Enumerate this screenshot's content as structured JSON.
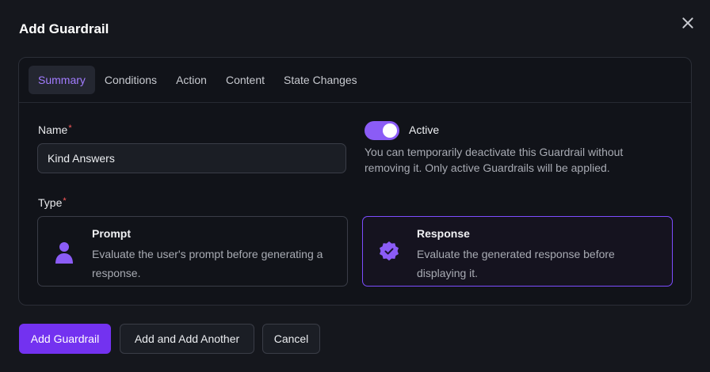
{
  "modal": {
    "title": "Add Guardrail"
  },
  "tabs": [
    {
      "label": "Summary",
      "active": true
    },
    {
      "label": "Conditions",
      "active": false
    },
    {
      "label": "Action",
      "active": false
    },
    {
      "label": "Content",
      "active": false
    },
    {
      "label": "State Changes",
      "active": false
    }
  ],
  "form": {
    "name_label": "Name",
    "name_value": "Kind Answers",
    "required_mark": "*",
    "active_label": "Active",
    "active_enabled": true,
    "active_description": "You can temporarily deactivate this Guardrail without removing it. Only active Guardrails will be applied.",
    "type_label": "Type",
    "types": [
      {
        "title": "Prompt",
        "description": "Evaluate the user's prompt before generating a response.",
        "icon": "user-icon",
        "selected": false
      },
      {
        "title": "Response",
        "description": "Evaluate the generated response before displaying it.",
        "icon": "verified-badge-icon",
        "selected": true
      }
    ]
  },
  "footer": {
    "primary_label": "Add Guardrail",
    "add_another_label": "Add and Add Another",
    "cancel_label": "Cancel"
  },
  "colors": {
    "accent": "#7332f0",
    "accent_light": "#a27cff",
    "toggle_on": "#8b5cf6",
    "required": "#ff5c5c"
  }
}
